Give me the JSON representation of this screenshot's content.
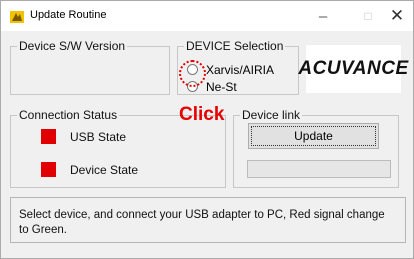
{
  "window": {
    "title": "Update Routine",
    "icon": "app-icon",
    "controls": {
      "minimize": "–",
      "maximize": "□",
      "close": "✕"
    }
  },
  "version_group": {
    "label": "Device S/W Version",
    "value": ""
  },
  "device_selection": {
    "label": "DEVICE Selection",
    "options": [
      "Xarvis/AIRIA",
      "Ne-St"
    ],
    "selected": null
  },
  "logo": {
    "text": "ACUVANCE"
  },
  "annotation": {
    "text": "Click",
    "color": "#e60000"
  },
  "connection_status": {
    "label": "Connection Status",
    "items": [
      {
        "label": "USB State",
        "status_color": "#e00000"
      },
      {
        "label": "Device State",
        "status_color": "#e00000"
      }
    ]
  },
  "device_link": {
    "label": "Device link",
    "update_button": "Update",
    "progress": 0
  },
  "message": "Select device, and connect your USB adapter to PC, Red signal change to Green."
}
